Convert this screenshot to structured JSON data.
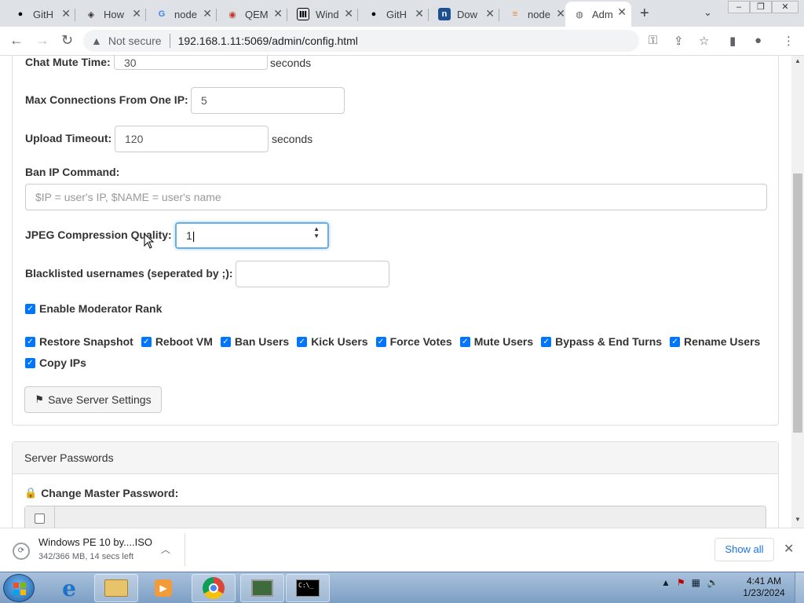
{
  "browser": {
    "tabs": [
      {
        "title": "GitH",
        "icon": "github-icon"
      },
      {
        "title": "How",
        "icon": "stackexchange-icon"
      },
      {
        "title": "node",
        "icon": "google-icon"
      },
      {
        "title": "QEM",
        "icon": "qemu-icon"
      },
      {
        "title": "Wind",
        "icon": "windows-archive-icon"
      },
      {
        "title": "GitH",
        "icon": "github-icon"
      },
      {
        "title": "Dow",
        "icon": "nvidia-icon"
      },
      {
        "title": "node",
        "icon": "stackoverflow-icon"
      },
      {
        "title": "Adm",
        "icon": "globe-icon"
      }
    ],
    "active_tab_index": 8,
    "omnibox": {
      "security": "Not secure",
      "url": "192.168.1.11:5069/admin/config.html"
    }
  },
  "form": {
    "chat_mute": {
      "label": "Chat Mute Time:",
      "value": "30",
      "suffix": "seconds"
    },
    "max_connections": {
      "label": "Max Connections From One IP:",
      "value": "5"
    },
    "upload_timeout": {
      "label": "Upload Timeout:",
      "value": "120",
      "suffix": "seconds"
    },
    "ban_ip": {
      "label": "Ban IP Command:",
      "placeholder": "$IP = user's IP, $NAME = user's name"
    },
    "jpeg_quality": {
      "label": "JPEG Compression Quality:",
      "value": "1"
    },
    "blacklist": {
      "label": "Blacklisted usernames (seperated by ;):",
      "value": ""
    },
    "enable_mod": {
      "label": "Enable Moderator Rank",
      "checked": true
    },
    "permissions": [
      {
        "label": "Restore Snapshot",
        "checked": true
      },
      {
        "label": "Reboot VM",
        "checked": true
      },
      {
        "label": "Ban Users",
        "checked": true
      },
      {
        "label": "Kick Users",
        "checked": true
      },
      {
        "label": "Force Votes",
        "checked": true
      },
      {
        "label": "Mute Users",
        "checked": true
      },
      {
        "label": "Bypass & End Turns",
        "checked": true
      },
      {
        "label": "Rename Users",
        "checked": true
      },
      {
        "label": "Copy IPs",
        "checked": true
      }
    ],
    "save_label": "Save Server Settings"
  },
  "passwords": {
    "heading": "Server Passwords",
    "change_master_label": "Change Master Password:"
  },
  "downloads": {
    "file": "Windows PE 10 by....ISO",
    "status": "342/366 MB, 14 secs left",
    "show_all": "Show all"
  },
  "taskbar": {
    "time": "4:41 AM",
    "date": "1/23/2024",
    "apps": [
      "internet-explorer-icon",
      "file-explorer-icon",
      "media-player-icon",
      "chrome-icon",
      "network-monitor-icon",
      "command-prompt-icon"
    ]
  }
}
